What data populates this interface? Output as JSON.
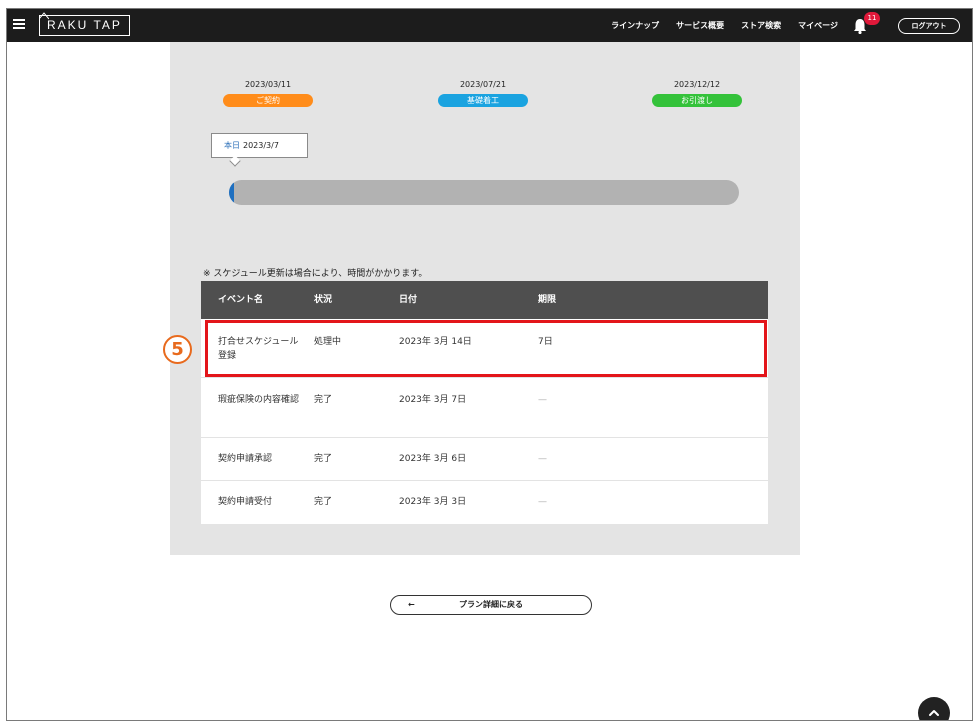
{
  "header": {
    "logo": "RAKU TAP",
    "nav": [
      "ラインナップ",
      "サービス概要",
      "ストア検索",
      "マイページ"
    ],
    "notification_count": "11",
    "logout": "ログアウト"
  },
  "timeline": {
    "milestones": [
      {
        "date": "2023/03/11",
        "label": "ご契約",
        "color": "#ff8c1a"
      },
      {
        "date": "2023/07/21",
        "label": "基礎着工",
        "color": "#1aa3e0"
      },
      {
        "date": "2023/12/12",
        "label": "お引渡し",
        "color": "#34c23a"
      }
    ],
    "today_label": "本日",
    "today_date": "2023/3/7",
    "progress": 0.01,
    "progress_color": "#1e6fc0"
  },
  "schedule": {
    "note": "※ スケジュール更新は場合により、時間がかかります。",
    "columns": [
      "イベント名",
      "状況",
      "日付",
      "期限"
    ],
    "rows": [
      {
        "event": "打合せスケジュール登録",
        "status": "処理中",
        "date": "2023年 3月 14日",
        "deadline": "7日"
      },
      {
        "event": "瑕疵保険の内容確認",
        "status": "完了",
        "date": "2023年 3月 7日",
        "deadline": "—"
      },
      {
        "event": "契約申請承認",
        "status": "完了",
        "date": "2023年 3月 6日",
        "deadline": "—"
      },
      {
        "event": "契約申請受付",
        "status": "完了",
        "date": "2023年 3月 3日",
        "deadline": "—"
      }
    ]
  },
  "annotation": {
    "marker": "5",
    "highlight_color": "#e3151a"
  },
  "back_button": {
    "arrow": "←",
    "label": "プラン詳細に戻る"
  }
}
